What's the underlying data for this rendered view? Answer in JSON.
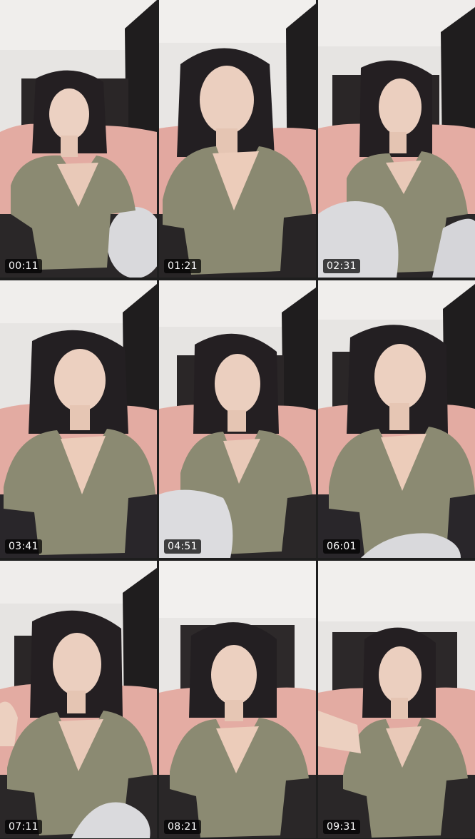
{
  "thumbnails": [
    {
      "timestamp": "00:11"
    },
    {
      "timestamp": "01:21"
    },
    {
      "timestamp": "02:31"
    },
    {
      "timestamp": "03:41"
    },
    {
      "timestamp": "04:51"
    },
    {
      "timestamp": "06:01"
    },
    {
      "timestamp": "07:11"
    },
    {
      "timestamp": "08:21"
    },
    {
      "timestamp": "09:31"
    }
  ],
  "colors": {
    "background": "#1e1e1e",
    "wall": "#e8e6e4",
    "ceiling": "#f1efed",
    "dark_panel": "#1f1d1e",
    "bedding": "#e2a8a0",
    "top": "#8b8a72",
    "skin": "#ecd0c0",
    "hair": "#231f22",
    "timestamp_bg": "#000000",
    "timestamp_text": "#ffffff"
  }
}
